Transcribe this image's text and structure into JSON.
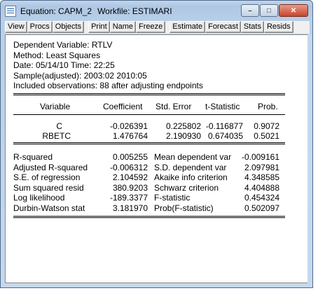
{
  "window": {
    "title": "Equation: CAPM_2",
    "workfile": "Workfile: ESTIMARI"
  },
  "toolbar": {
    "groups": [
      [
        "View",
        "Procs",
        "Objects"
      ],
      [
        "Print",
        "Name",
        "Freeze"
      ],
      [
        "Estimate",
        "Forecast",
        "Stats",
        "Resids"
      ]
    ]
  },
  "header": {
    "dependent": "Dependent Variable: RTLV",
    "method": "Method: Least Squares",
    "date": "Date: 05/14/10   Time: 22:25",
    "sample": "Sample(adjusted): 2003:02 2010:05",
    "observations": "Included observations: 88 after adjusting endpoints"
  },
  "coef_table": {
    "columns": [
      "Variable",
      "Coefficient",
      "Std. Error",
      "t-Statistic",
      "Prob."
    ],
    "rows": [
      [
        "C",
        "-0.026391",
        "0.225802",
        "-0.116877",
        "0.9072"
      ],
      [
        "RBETC",
        "1.476764",
        "2.190930",
        "0.674035",
        "0.5021"
      ]
    ]
  },
  "stats": {
    "rows": [
      [
        "R-squared",
        "0.005255",
        "Mean dependent var",
        "-0.009161"
      ],
      [
        "Adjusted R-squared",
        "-0.006312",
        "S.D. dependent var",
        "2.097981"
      ],
      [
        "S.E. of regression",
        "2.104592",
        "Akaike info criterion",
        "4.348585"
      ],
      [
        "Sum squared resid",
        "380.9203",
        "Schwarz criterion",
        "4.404888"
      ],
      [
        "Log likelihood",
        "-189.3377",
        "F-statistic",
        "0.454324"
      ],
      [
        "Durbin-Watson stat",
        "3.181970",
        "Prob(F-statistic)",
        "0.502097"
      ]
    ]
  },
  "icons": {
    "app": "equation-window-icon",
    "minimize": "minimize-icon",
    "maximize": "maximize-icon",
    "close": "close-icon"
  }
}
